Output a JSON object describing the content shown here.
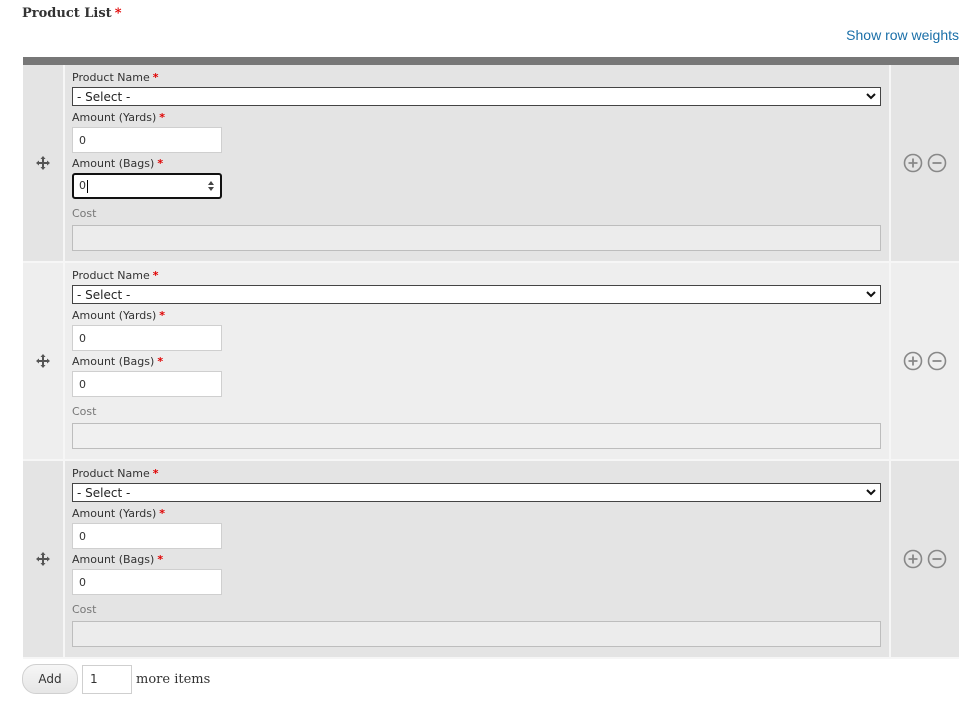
{
  "field": {
    "title": "Product List",
    "required_marker": "*",
    "show_weights_link": "Show row weights"
  },
  "rows": [
    {
      "product_name_label": "Product Name",
      "product_name_value": "- Select -",
      "yards_label": "Amount (Yards)",
      "yards_value": "0",
      "bags_label": "Amount (Bags)",
      "bags_value": "0",
      "cost_label": "Cost",
      "cost_value": ""
    },
    {
      "product_name_label": "Product Name",
      "product_name_value": "- Select -",
      "yards_label": "Amount (Yards)",
      "yards_value": "0",
      "bags_label": "Amount (Bags)",
      "bags_value": "0",
      "cost_label": "Cost",
      "cost_value": ""
    },
    {
      "product_name_label": "Product Name",
      "product_name_value": "- Select -",
      "yards_label": "Amount (Yards)",
      "yards_value": "0",
      "bags_label": "Amount (Bags)",
      "bags_value": "0",
      "cost_label": "Cost",
      "cost_value": ""
    }
  ],
  "footer": {
    "add_label": "Add",
    "count_value": "1",
    "more_items_text": "more items"
  },
  "icons": {
    "drag": "drag-handle-icon",
    "add_row": "plus-circle-icon",
    "remove_row": "minus-circle-icon",
    "dropdown": "chevron-down-icon",
    "spinner": "spin-arrows-icon"
  },
  "colors": {
    "required": "#e00000",
    "link": "#1a6fa8",
    "header_bar": "#777777",
    "row_odd": "#e4e4e4",
    "row_even": "#eeeeee"
  }
}
